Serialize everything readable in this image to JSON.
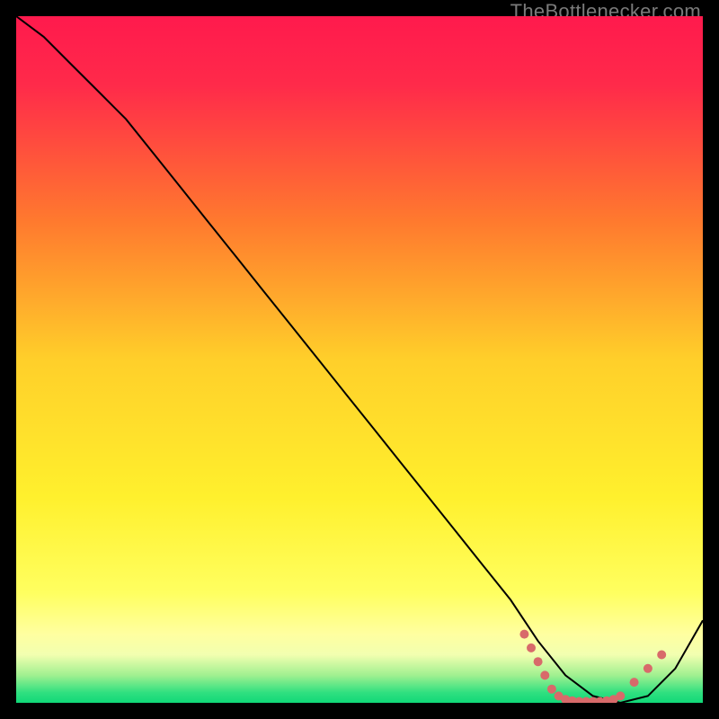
{
  "watermark": "TheBottlenecker.com",
  "chart_data": {
    "type": "line",
    "title": "",
    "xlabel": "",
    "ylabel": "",
    "xlim": [
      0,
      100
    ],
    "ylim": [
      0,
      100
    ],
    "grid": false,
    "background_gradient": {
      "description": "vertical gradient red→orange→yellow→green, with very compressed green band near bottom",
      "stops": [
        {
          "offset": 0.0,
          "color": "#ff1a4d"
        },
        {
          "offset": 0.1,
          "color": "#ff2a4a"
        },
        {
          "offset": 0.3,
          "color": "#ff7a2e"
        },
        {
          "offset": 0.5,
          "color": "#ffcf2a"
        },
        {
          "offset": 0.7,
          "color": "#fff02d"
        },
        {
          "offset": 0.84,
          "color": "#ffff60"
        },
        {
          "offset": 0.9,
          "color": "#ffffa0"
        },
        {
          "offset": 0.93,
          "color": "#f2ffb0"
        },
        {
          "offset": 0.96,
          "color": "#a0f090"
        },
        {
          "offset": 0.985,
          "color": "#30e080"
        },
        {
          "offset": 1.0,
          "color": "#10d878"
        }
      ]
    },
    "series": [
      {
        "name": "curve",
        "color": "#000000",
        "stroke_width": 2,
        "x": [
          0,
          4,
          8,
          12,
          16,
          20,
          24,
          28,
          32,
          36,
          40,
          44,
          48,
          52,
          56,
          60,
          64,
          68,
          72,
          76,
          80,
          84,
          88,
          92,
          96,
          100
        ],
        "y": [
          100,
          97,
          93,
          89,
          85,
          80,
          75,
          70,
          65,
          60,
          55,
          50,
          45,
          40,
          35,
          30,
          25,
          20,
          15,
          9,
          4,
          1,
          0,
          1,
          5,
          12
        ]
      }
    ],
    "markers": {
      "name": "dotted-minimum",
      "color": "#d86a6a",
      "radius": 5,
      "points": [
        {
          "x": 74,
          "y": 10
        },
        {
          "x": 75,
          "y": 8
        },
        {
          "x": 76,
          "y": 6
        },
        {
          "x": 77,
          "y": 4
        },
        {
          "x": 78,
          "y": 2
        },
        {
          "x": 79,
          "y": 1
        },
        {
          "x": 80,
          "y": 0.5
        },
        {
          "x": 81,
          "y": 0.3
        },
        {
          "x": 82,
          "y": 0.2
        },
        {
          "x": 83,
          "y": 0.2
        },
        {
          "x": 84,
          "y": 0.2
        },
        {
          "x": 85,
          "y": 0.2
        },
        {
          "x": 86,
          "y": 0.3
        },
        {
          "x": 87,
          "y": 0.5
        },
        {
          "x": 88,
          "y": 1
        },
        {
          "x": 90,
          "y": 3
        },
        {
          "x": 92,
          "y": 5
        },
        {
          "x": 94,
          "y": 7
        }
      ]
    }
  }
}
